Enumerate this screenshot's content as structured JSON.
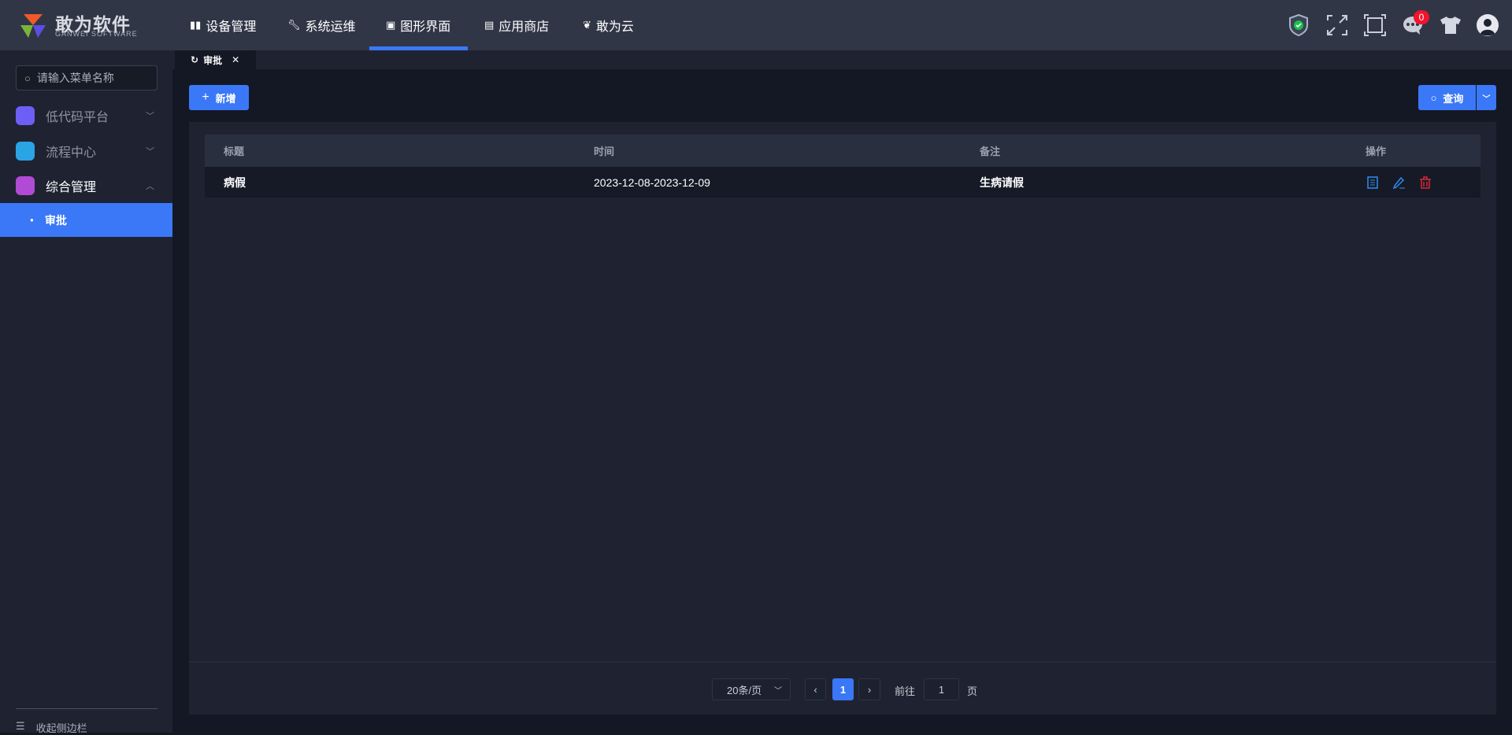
{
  "brand": {
    "name": "敢为软件",
    "sub": "GANWEI SOFTWARE"
  },
  "nav": [
    {
      "label": "设备管理",
      "icon": "book-icon"
    },
    {
      "label": "系统运维",
      "icon": "wrench-icon"
    },
    {
      "label": "图形界面",
      "icon": "monitor-icon",
      "active": true
    },
    {
      "label": "应用商店",
      "icon": "store-icon"
    },
    {
      "label": "敢为云",
      "icon": "cloud-icon"
    }
  ],
  "header_icons": {
    "message_count": "0"
  },
  "sidebar": {
    "search_placeholder": "请输入菜单名称",
    "items": [
      {
        "label": "低代码平台",
        "color": "#6d5ff5",
        "expanded": false
      },
      {
        "label": "流程中心",
        "color": "#2ba4e6",
        "expanded": false
      },
      {
        "label": "综合管理",
        "color": "#b14bd6",
        "expanded": true
      }
    ],
    "active_sub": "审批",
    "collapse_label": "收起侧边栏"
  },
  "tabs": [
    {
      "label": "审批"
    }
  ],
  "toolbar": {
    "add_label": "新增",
    "query_label": "查询"
  },
  "table": {
    "columns": [
      "标题",
      "时间",
      "备注",
      "操作"
    ],
    "rows": [
      {
        "title": "病假",
        "time": "2023-12-08-2023-12-09",
        "remark": "生病请假"
      }
    ]
  },
  "pagination": {
    "page_size": "20条/页",
    "current_page": "1",
    "goto_label": "前往",
    "goto_value": "1",
    "page_suffix": "页"
  },
  "colors": {
    "accent": "#3a78f7",
    "danger": "#d6283a"
  }
}
